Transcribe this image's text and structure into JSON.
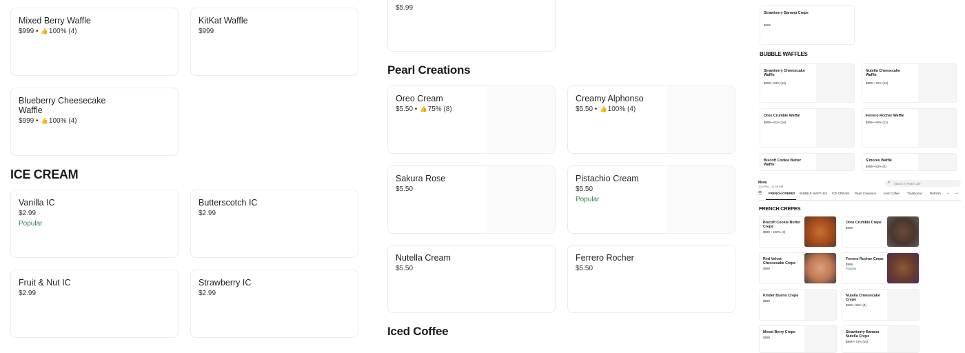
{
  "col1": {
    "waffles": [
      {
        "name": "Mixed Berry Waffle",
        "price": "$999",
        "rating": "100% (4)"
      },
      {
        "name": "KitKat Waffle",
        "price": "$999"
      },
      {
        "name": "Blueberry Cheesecake Waffle",
        "price": "$999",
        "rating": "100% (4)"
      }
    ],
    "ice_cream_title": "ICE CREAM",
    "ice_cream": [
      {
        "name": "Vanilla IC",
        "price": "$2.99",
        "badge": "Popular"
      },
      {
        "name": "Butterscotch IC",
        "price": "$2.99"
      },
      {
        "name": "Fruit & Nut IC",
        "price": "$2.99"
      },
      {
        "name": "Strawberry IC",
        "price": "$2.99"
      }
    ]
  },
  "col2": {
    "top_price": "$5.99",
    "pearl_title": "Pearl Creations",
    "pearl": [
      {
        "name": "Oreo Cream",
        "price": "$5.50",
        "rating": "75% (8)"
      },
      {
        "name": "Creamy Alphonso",
        "price": "$5.50",
        "rating": "100% (4)"
      },
      {
        "name": "Sakura Rose",
        "price": "$5.50"
      },
      {
        "name": "Pistachio Cream",
        "price": "$5.50",
        "badge": "Popular"
      },
      {
        "name": "Nutella Cream",
        "price": "$5.50"
      },
      {
        "name": "Ferrero Rocher",
        "price": "$5.50"
      }
    ],
    "iced_title": "Iced Coffee"
  },
  "preview_top": {
    "crepe_item": {
      "name": "Strawberry Banana Crepe",
      "price": "$999"
    },
    "bubble_title": "BUBBLE WAFFLES",
    "items": [
      {
        "name": "Strawberry Cheesecake Waffle",
        "meta": "$999 • 93% (16)"
      },
      {
        "name": "Nutella Cheesecake Waffle",
        "meta": "$999 • 76% (13)"
      },
      {
        "name": "Oreo Crumble Waffle",
        "meta": "$999 • 81% (16)"
      },
      {
        "name": "Ferrero Rocher Waffle",
        "meta": "$999 • 90% (11)"
      },
      {
        "name": "Biscoff Cookie Butter Waffle",
        "meta": ""
      },
      {
        "name": "S'mores Waffle",
        "meta": "$999 • 83% (6)"
      }
    ]
  },
  "preview_bottom": {
    "menu_label": "Menu",
    "hours": "1:00 PM – 11:59 PM",
    "search_placeholder": "Search in Pearl Cafe",
    "tabs": [
      "FRENCH CREPES",
      "BUBBLE WAFFLES",
      "ICE CREAM",
      "Pearl Creations",
      "Iced Coffee",
      "Traditional",
      "Refresh"
    ],
    "section_title": "FRENCH CREPES",
    "items": [
      {
        "name": "Biscoff Cookie Butter Crepe",
        "meta": "$999 • 100% (3)"
      },
      {
        "name": "Oreo Crumble Crepe",
        "meta": "$999"
      },
      {
        "name": "Red Velvet Cheesecake Crepe",
        "meta": "$999"
      },
      {
        "name": "Ferrero Rocher Crepe",
        "meta": "$999",
        "badge": "Popular"
      },
      {
        "name": "Kinder Bueno Crepe",
        "meta": "$999"
      },
      {
        "name": "Nutella Cheesecake Crepe",
        "meta": "$999 • 96% (3)"
      },
      {
        "name": "Mixed Berry Crepe",
        "meta": "$999"
      },
      {
        "name": "Strawberry Banana Nutella Crepe",
        "meta": "$999 • 73% (15)"
      }
    ]
  },
  "colors": {
    "popular": "#2e7d4f",
    "tab_active": "#111111"
  }
}
